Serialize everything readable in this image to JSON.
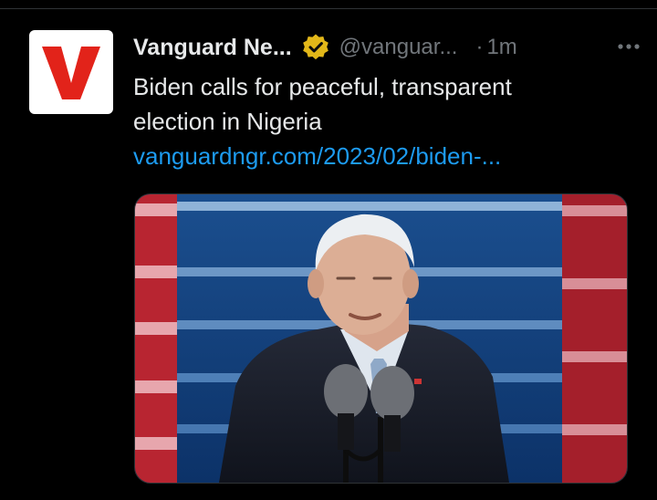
{
  "tweet": {
    "author": {
      "display_name": "Vanguard Ne...",
      "handle": "@vanguar...",
      "avatar_letter": "V",
      "verified": true
    },
    "separator": "·",
    "time": "1m",
    "text_lines": [
      "Biden calls for peaceful, transparent",
      "election in Nigeria"
    ],
    "link": "vanguardngr.com/2023/02/biden-..."
  },
  "colors": {
    "link": "#1d9bf0",
    "secondary_text": "#71767b",
    "verified_badge": "#e2b719",
    "brand_red": "#e2231a"
  },
  "icons": {
    "verified": "verified-badge-icon",
    "more": "more-horizontal-icon"
  }
}
